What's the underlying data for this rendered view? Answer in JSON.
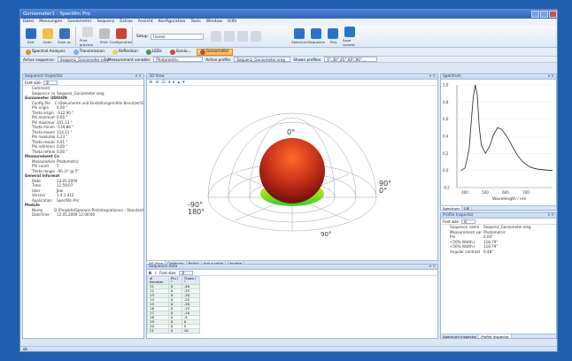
{
  "app": {
    "title": "Goniometer1 - SpecWin Pro"
  },
  "menu": [
    "Datei",
    "Messungen",
    "Goniometer",
    "Sequenz",
    "Extras",
    "Ansicht",
    "Konfiguration",
    "Tools",
    "Window",
    "Hilfe"
  ],
  "ribbon": {
    "buttons": [
      "Exit",
      "Open",
      "Save as",
      "Print preview",
      "Print",
      "Configuration",
      "Spectrum",
      "Sequence",
      "Plus",
      "Save current"
    ],
    "setup_label": "Setup:",
    "setup_value": "(none)"
  },
  "modes": {
    "items": [
      "Spectral Analysis",
      "Transmission",
      "Reflection",
      "LEDs",
      "Gonio..."
    ],
    "active_label": "Goniometer"
  },
  "seqbar": {
    "active_seq_label": "Active sequence:",
    "active_seq_value": "Sequenz_Goniometer.sreg",
    "measurement_label": "Measurement variable:",
    "measurement_value": "Photometric",
    "profile_label": "Active profile:",
    "profile_value": "Sequenz_Goniometer.sreg",
    "shown_label": "Shown profiles:",
    "shown_value": "0°,30°,45°,60°,90°,..."
  },
  "inspector": {
    "title": "Sequence Inspector",
    "font_label": "Font size:",
    "font_value": "8",
    "rows": [
      {
        "cat": false,
        "k": "Comment",
        "v": ""
      },
      {
        "cat": false,
        "k": "Sequence name",
        "v": "Sequenz_Goniometer.sreg"
      },
      {
        "cat": true,
        "k": "Goniometer",
        "v": "UDIGON"
      },
      {
        "cat": false,
        "k": "Config file",
        "v": "C:\\Dokumente und Einstellungen\\Alle Benutzer\\Gon..."
      },
      {
        "cat": false,
        "k": "Phi origin",
        "v": "0,00 °"
      },
      {
        "cat": false,
        "k": "Theta origin",
        "v": "-112,90 °"
      },
      {
        "cat": false,
        "k": "Phi minimum",
        "v": "0,00 °"
      },
      {
        "cat": false,
        "k": "Phi maximum",
        "v": "351,13 °"
      },
      {
        "cat": false,
        "k": "Theta minimum",
        "v": "-119,86 °"
      },
      {
        "cat": false,
        "k": "Theta maximum",
        "v": "114,11 °"
      },
      {
        "cat": false,
        "k": "Phi resolution",
        "v": "0,23 °"
      },
      {
        "cat": false,
        "k": "Theta resolution",
        "v": "0,01 °"
      },
      {
        "cat": false,
        "k": "Phi reference",
        "v": "0,00 °"
      },
      {
        "cat": false,
        "k": "Theta reference",
        "v": "0,00 °"
      },
      {
        "cat": true,
        "k": "Measurement Co",
        "v": ""
      },
      {
        "cat": false,
        "k": "Measurement var",
        "v": "Photometric"
      },
      {
        "cat": false,
        "k": "Phi count",
        "v": "5"
      },
      {
        "cat": false,
        "k": "Theta ranges",
        "v": "-90..0° @ 5°"
      },
      {
        "cat": true,
        "k": "General Informat",
        "v": ""
      },
      {
        "cat": false,
        "k": "Date",
        "v": "12.05.2009"
      },
      {
        "cat": false,
        "k": "Time",
        "v": "11:59:07"
      },
      {
        "cat": false,
        "k": "User",
        "v": "Jkw"
      },
      {
        "cat": false,
        "k": "Version",
        "v": "1.4.1.412"
      },
      {
        "cat": false,
        "k": "Application",
        "v": "SpecWin Pro"
      },
      {
        "cat": true,
        "k": "Module",
        "v": ""
      },
      {
        "cat": false,
        "k": "Name",
        "v": "D:\\Projekte\\Specwin Pro\\Integrationen - Standard Fac..."
      },
      {
        "cat": false,
        "k": "DateTime",
        "v": "12.05.2009 12:00:00"
      }
    ]
  },
  "view3d": {
    "title": "3D View",
    "labels": {
      "top": "0°",
      "left": "-90°",
      "left2": "180°",
      "right": "90°",
      "right2": "0°",
      "bottom": "90°"
    },
    "tabs": [
      "3D View",
      "Cartesian",
      "Radial",
      "Isolux table",
      "Candela"
    ]
  },
  "seqdata": {
    "title": "Sequence data",
    "font_label": "Font size:",
    "font_value": "8",
    "headers": [
      "# Number",
      "Phi / °",
      "Theta / °"
    ],
    "rows": [
      [
        "11",
        "0",
        "-40"
      ],
      [
        "12",
        "0",
        "-35"
      ],
      [
        "13",
        "0",
        "-30"
      ],
      [
        "14",
        "0",
        "-25"
      ],
      [
        "15",
        "0",
        "-20"
      ],
      [
        "16",
        "0",
        "-15"
      ],
      [
        "17",
        "0",
        "-10"
      ],
      [
        "18",
        "0",
        "-5"
      ],
      [
        "19",
        "0",
        "0"
      ],
      [
        "20",
        "0",
        "5"
      ],
      [
        "21",
        "0",
        "10"
      ]
    ]
  },
  "spectrum": {
    "title": "Spectrum",
    "xlabel": "Wavelength / nm",
    "xticks": [
      "400",
      "500",
      "600",
      "700"
    ],
    "yticks": [
      "1,0",
      "0,8",
      "0,6",
      "0,4",
      "0,2",
      "0,0",
      "-0,2"
    ],
    "tabs": [
      "Spectrum",
      "CIE"
    ]
  },
  "profile": {
    "title": "Profile Inspector",
    "font_label": "Font size:",
    "font_value": "8",
    "rows": [
      {
        "k": "Sequence name",
        "v": "Sequenz_Goniometer.sreg"
      },
      {
        "k": "Measurement variab",
        "v": "Photometric"
      },
      {
        "k": "Phi",
        "v": "0,00°"
      },
      {
        "k": "<50% Width+",
        "v": "118,79°"
      },
      {
        "k": "<50% Width+",
        "v": "118,79°"
      },
      {
        "k": "Angular contrast",
        "v": "0,48°"
      }
    ],
    "tabs": [
      "Spectrum Inspector",
      "Profile Inspector"
    ]
  },
  "status": {
    "text": "ok"
  },
  "chart_data": {
    "type": "line",
    "title": "",
    "xlabel": "Wavelength / nm",
    "ylabel": "",
    "xlim": [
      360,
      830
    ],
    "ylim": [
      -0.2,
      1.0
    ],
    "x": [
      380,
      400,
      420,
      440,
      450,
      460,
      470,
      480,
      500,
      520,
      540,
      560,
      580,
      600,
      620,
      640,
      660,
      680,
      700,
      720,
      740,
      760,
      780,
      800,
      830
    ],
    "series": [
      {
        "values": [
          0.0,
          0.03,
          0.25,
          0.85,
          1.0,
          0.88,
          0.5,
          0.3,
          0.2,
          0.28,
          0.42,
          0.5,
          0.48,
          0.42,
          0.34,
          0.25,
          0.17,
          0.11,
          0.07,
          0.04,
          0.025,
          0.015,
          0.01,
          0.005,
          0.0
        ]
      }
    ]
  }
}
